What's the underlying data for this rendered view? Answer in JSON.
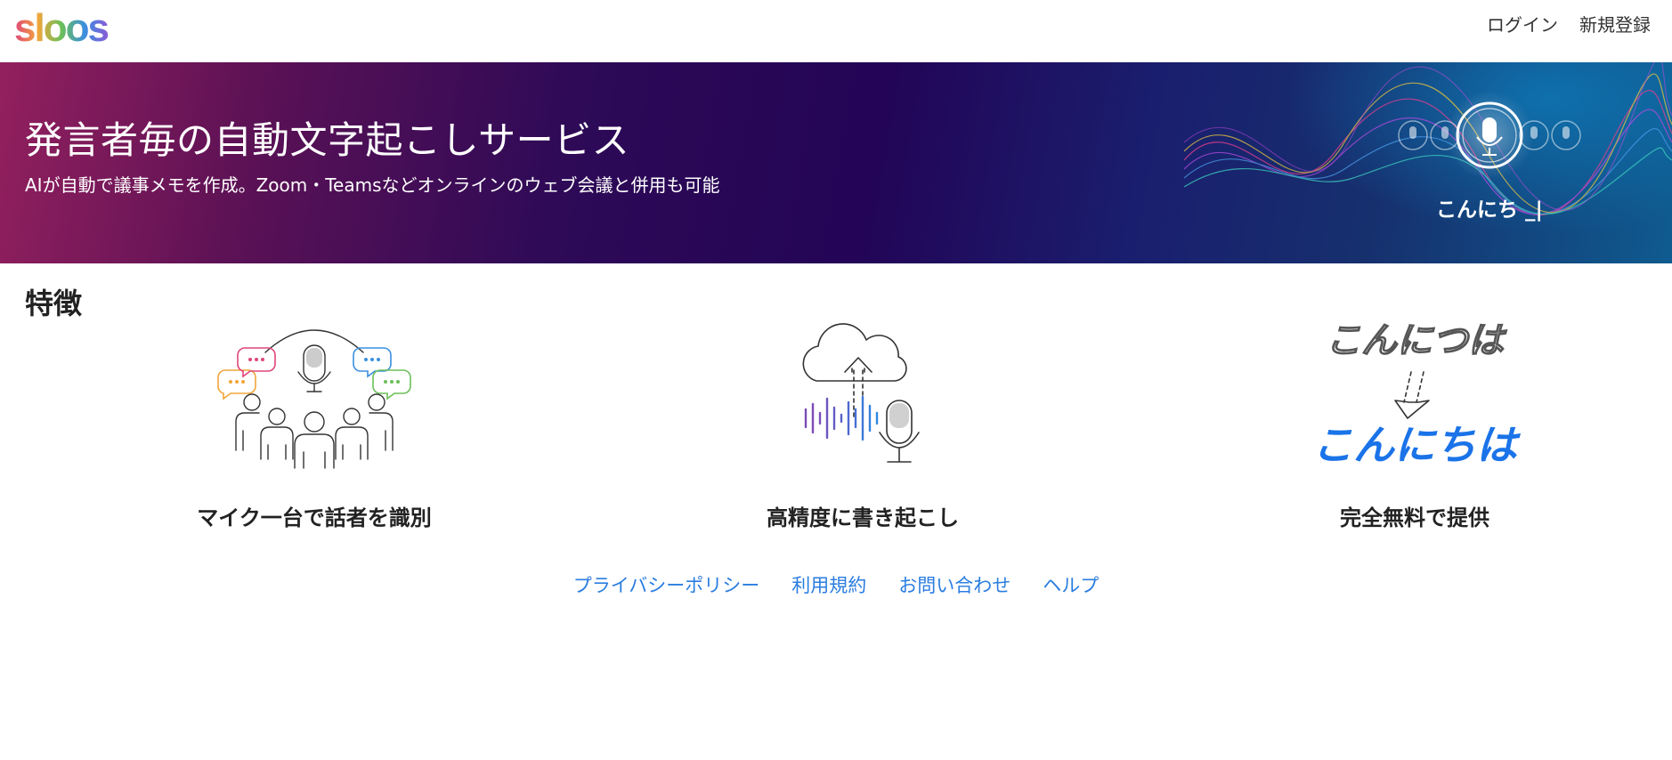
{
  "header": {
    "logo_text": "sloos",
    "nav": {
      "login": "ログイン",
      "register": "新規登録"
    }
  },
  "hero": {
    "title": "発言者毎の自動文字起こしサービス",
    "subtitle": "AIが自動で議事メモを作成。Zoom・Teamsなどオンラインのウェブ会議と併用も可能",
    "mic_caption": "こんにち _|"
  },
  "features": {
    "title": "特徴",
    "items": [
      {
        "label": "マイク一台で話者を識別",
        "icon": "speakers-microphone-icon"
      },
      {
        "label": "高精度に書き起こし",
        "icon": "cloud-upload-microphone-icon"
      },
      {
        "label": "完全無料で提供",
        "icon": "text-correction-icon",
        "text_before": "こんにつは",
        "text_after": "こんにちは"
      }
    ]
  },
  "footer": {
    "links": [
      {
        "label": "プライバシーポリシー"
      },
      {
        "label": "利用規約"
      },
      {
        "label": "お問い合わせ"
      },
      {
        "label": "ヘルプ"
      }
    ]
  },
  "colors": {
    "link_blue": "#2b7de0",
    "hero_start": "#93205e",
    "hero_mid": "#230456",
    "hero_end": "#0f5b8f",
    "correct_text_blue": "#1a73e8",
    "logo_s1": "#e0457b",
    "logo_l": "#f2a53a",
    "logo_o1": "#6bbf59",
    "logo_o2": "#3b8fe0",
    "logo_s2": "#8a5ad6"
  }
}
